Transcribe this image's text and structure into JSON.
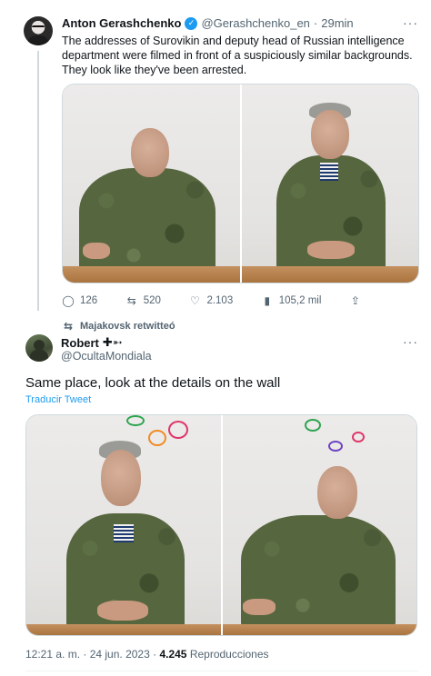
{
  "quoted_tweet": {
    "author_name": "Anton Gerashchenko",
    "verified_glyph": "✓",
    "handle": "@Gerashchenko_en",
    "separator": "·",
    "time": "29min",
    "more_glyph": "···",
    "text": "The addresses of Surovikin and deputy head of Russian intelligence department were filmed in front of a suspiciously similar backgrounds. They look like they've been arrested.",
    "stats": {
      "replies": "126",
      "retweets": "520",
      "likes": "2.103",
      "views": "105,2 mil"
    },
    "icons": {
      "reply": "reply-icon",
      "retweet": "retweet-icon",
      "like": "heart-icon",
      "views": "views-icon",
      "share": "share-icon"
    }
  },
  "retweet_banner": {
    "text": "Majakovsk retwitteó"
  },
  "main_tweet": {
    "author_name": "Robert",
    "name_emoji": "✚➵",
    "handle": "@OcultaMondiala",
    "more_glyph": "···",
    "text": "Same place, look at the details on the wall",
    "translate_link": "Traducir Tweet",
    "timestamp": "12:21 a. m. · 24 jun. 2023 ·",
    "views_count": "4.245",
    "views_label": "Reproducciones"
  },
  "colors": {
    "accent": "#1d9bf0",
    "muted": "#536471",
    "circle_green": "#2ea44f",
    "circle_orange": "#f08a24",
    "circle_pink": "#e0366a",
    "circle_purple": "#6f42c1"
  }
}
